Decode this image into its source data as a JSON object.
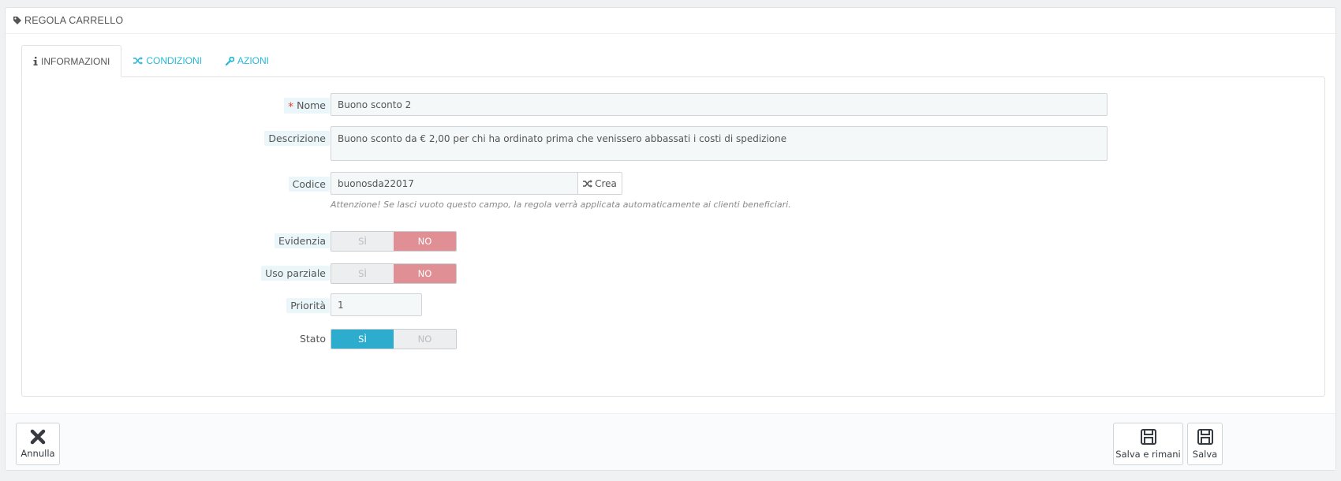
{
  "panel": {
    "title": "REGOLA CARRELLO"
  },
  "tabs": [
    {
      "label": "INFORMAZIONI",
      "icon": "info-icon",
      "active": true
    },
    {
      "label": "CONDIZIONI",
      "icon": "shuffle-icon",
      "active": false
    },
    {
      "label": "AZIONI",
      "icon": "wrench-icon",
      "active": false
    }
  ],
  "form": {
    "name": {
      "label": "Nome",
      "required_mark": "*",
      "value": "Buono sconto 2"
    },
    "description": {
      "label": "Descrizione",
      "value": "Buono sconto da € 2,00 per chi ha ordinato prima che venissero abbassati i costi di spedizione"
    },
    "code": {
      "label": "Codice",
      "value": "buonosda22017",
      "generate_label": "Crea",
      "help": "Attenzione! Se lasci vuoto questo campo, la regola verrà applicata automaticamente ai clienti beneficiari."
    },
    "highlight": {
      "label": "Evidenzia",
      "yes": "SÌ",
      "no": "NO",
      "selected": "NO"
    },
    "partial_use": {
      "label": "Uso parziale",
      "yes": "SÌ",
      "no": "NO",
      "selected": "NO"
    },
    "priority": {
      "label": "Priorità",
      "value": "1"
    },
    "status": {
      "label": "Stato",
      "yes": "SÌ",
      "no": "NO",
      "selected": "SÌ"
    }
  },
  "footer": {
    "cancel_label": "Annulla",
    "save_stay_label": "Salva e rimani",
    "save_label": "Salva"
  },
  "colors": {
    "accent": "#25b9d7",
    "switch_on": "#2eacce",
    "switch_no": "#e08f95",
    "required": "#e3463b"
  }
}
